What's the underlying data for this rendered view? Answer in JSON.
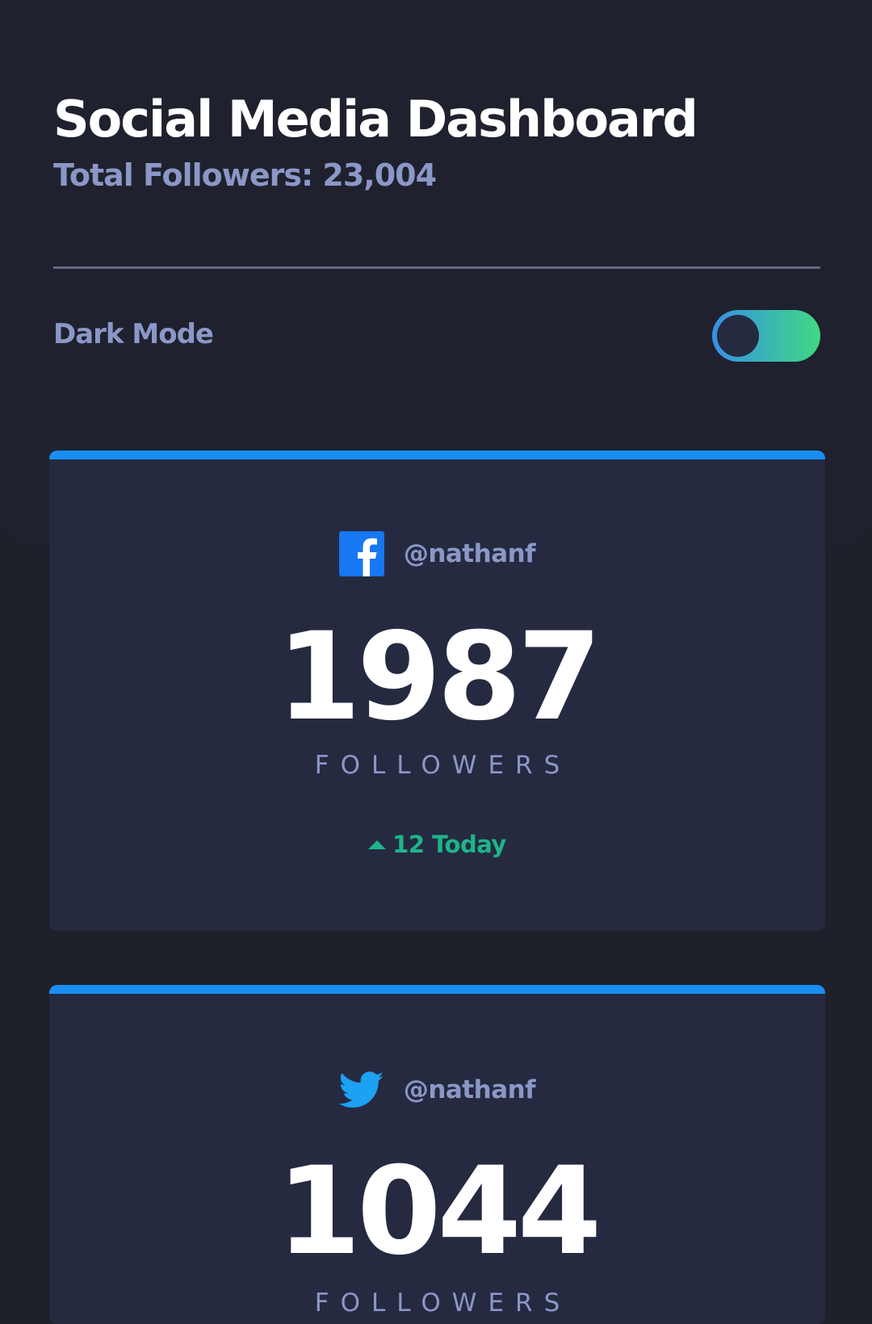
{
  "header": {
    "title": "Social Media Dashboard",
    "subtitle": "Total Followers: 23,004"
  },
  "dark_mode": {
    "label": "Dark Mode",
    "enabled": true
  },
  "cards": [
    {
      "icon": "facebook-icon",
      "handle": "@nathanf",
      "count": "1987",
      "count_label": "FOLLOWERS",
      "delta": "12 Today",
      "delta_direction": "up",
      "accent": "#198ff5"
    },
    {
      "icon": "twitter-icon",
      "handle": "@nathanf",
      "count": "1044",
      "count_label": "FOLLOWERS",
      "accent": "#1ca0f2"
    }
  ],
  "colors": {
    "background": "#1e202a",
    "top_panel": "#1f212e",
    "card": "#252a41",
    "text_primary": "#ffffff",
    "text_secondary": "#8b97c6",
    "positive": "#1eb589",
    "toggle_gradient_start": "#378fe6",
    "toggle_gradient_end": "#3eda82"
  }
}
